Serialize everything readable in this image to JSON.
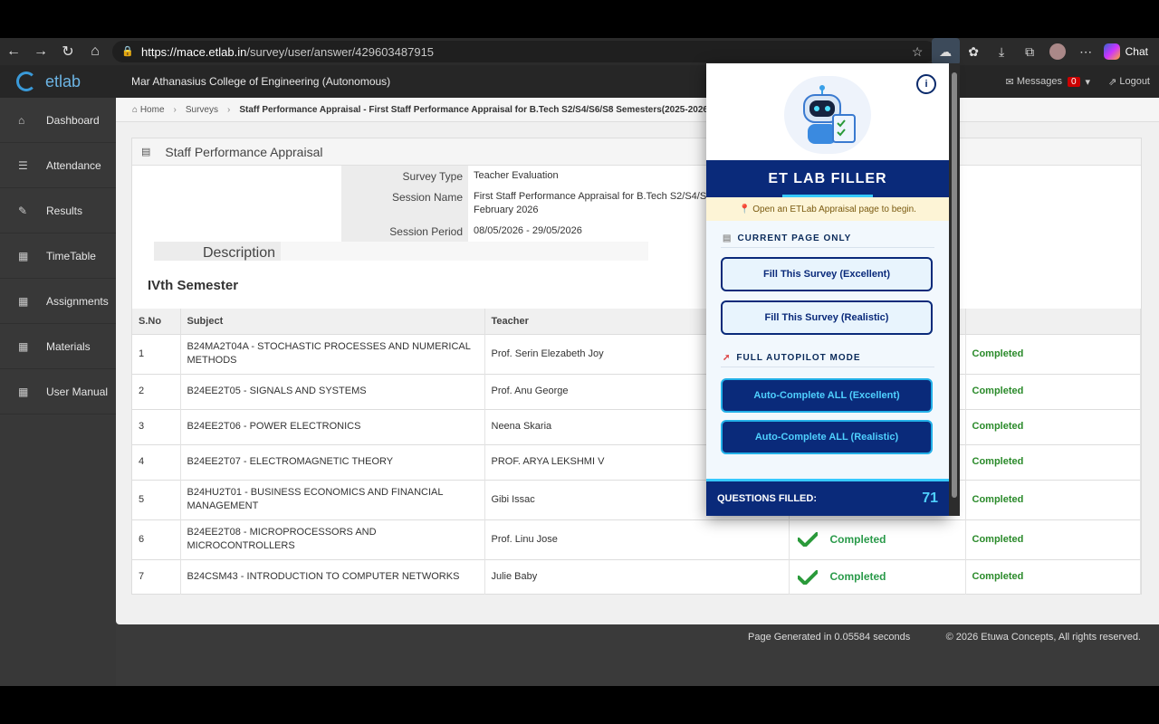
{
  "browser": {
    "url_host": "https://mace.etlab.in",
    "url_path": "/survey/user/answer/429603487915",
    "chat_label": "Chat"
  },
  "header": {
    "brand": "etlab",
    "college": "Mar Athanasius College of Engineering (Autonomous)",
    "messages_label": "Messages",
    "messages_count": "0",
    "logout_label": "Logout"
  },
  "sidebar": {
    "items": [
      {
        "label": "Dashboard",
        "icon": "home-icon"
      },
      {
        "label": "Attendance",
        "icon": "list-icon"
      },
      {
        "label": "Results",
        "icon": "edit-icon"
      },
      {
        "label": "TimeTable",
        "icon": "grid-icon"
      },
      {
        "label": "Assignments",
        "icon": "grid-icon"
      },
      {
        "label": "Materials",
        "icon": "grid-icon"
      },
      {
        "label": "User Manual",
        "icon": "grid-icon"
      }
    ]
  },
  "breadcrumb": {
    "home": "Home",
    "surveys": "Surveys",
    "current": "Staff Performance Appraisal - First Staff Performance Appraisal for B.Tech S2/S4/S6/S8 Semesters(2025-2026)- Febru"
  },
  "panel": {
    "title": "Staff Performance Appraisal",
    "survey_type_label": "Survey Type",
    "survey_type": "Teacher Evaluation",
    "session_name_label": "Session Name",
    "session_name": "First Staff Performance Appraisal for B.Tech S2/S4/S6",
    "session_name_cont": "February 2026",
    "session_period_label": "Session Period",
    "session_period": "08/05/2026 - 29/05/2026",
    "description_label": "Description",
    "semester": "IVth Semester"
  },
  "table": {
    "headers": [
      "S.No",
      "Subject",
      "Teacher"
    ],
    "rows": [
      {
        "sno": "1",
        "subject": "B24MA2T04A - STOCHASTIC PROCESSES AND NUMERICAL METHODS",
        "teacher": "Prof. Serin Elezabeth Joy",
        "status": "",
        "final": "Completed"
      },
      {
        "sno": "2",
        "subject": "B24EE2T05 - SIGNALS AND SYSTEMS",
        "teacher": "Prof. Anu George",
        "status": "",
        "final": "Completed"
      },
      {
        "sno": "3",
        "subject": "B24EE2T06 - POWER ELECTRONICS",
        "teacher": "Neena Skaria",
        "status": "",
        "final": "Completed"
      },
      {
        "sno": "4",
        "subject": "B24EE2T07 - ELECTROMAGNETIC THEORY",
        "teacher": "PROF. ARYA LEKSHMI V",
        "status": "",
        "final": "Completed"
      },
      {
        "sno": "5",
        "subject": "B24HU2T01 - BUSINESS ECONOMICS AND FINANCIAL MANAGEMENT",
        "teacher": "Gibi Issac",
        "status": "",
        "final": "Completed"
      },
      {
        "sno": "6",
        "subject": "B24EE2T08 - MICROPROCESSORS AND MICROCONTROLLERS",
        "teacher": "Prof. Linu Jose",
        "status": "Completed",
        "final": "Completed"
      },
      {
        "sno": "7",
        "subject": "B24CSM43 - INTRODUCTION TO COMPUTER NETWORKS",
        "teacher": "Julie Baby",
        "status": "Completed",
        "final": "Completed"
      }
    ]
  },
  "footer": {
    "generated": "Page Generated in 0.05584 seconds",
    "copyright": "© 2026 Etuwa Concepts, All rights reserved."
  },
  "popup": {
    "info_icon": "i",
    "title": "ET LAB FILLER",
    "notice": "📍 Open an ETLab Appraisal page to begin.",
    "current_section": "CURRENT PAGE ONLY",
    "fill_excellent": "Fill This Survey (Excellent)",
    "fill_realistic": "Fill This Survey (Realistic)",
    "autopilot_section": "FULL AUTOPILOT MODE",
    "auto_excellent": "Auto-Complete ALL (Excellent)",
    "auto_realistic": "Auto-Complete ALL (Realistic)",
    "questions_label": "QUESTIONS FILLED:",
    "questions_count": "71"
  }
}
